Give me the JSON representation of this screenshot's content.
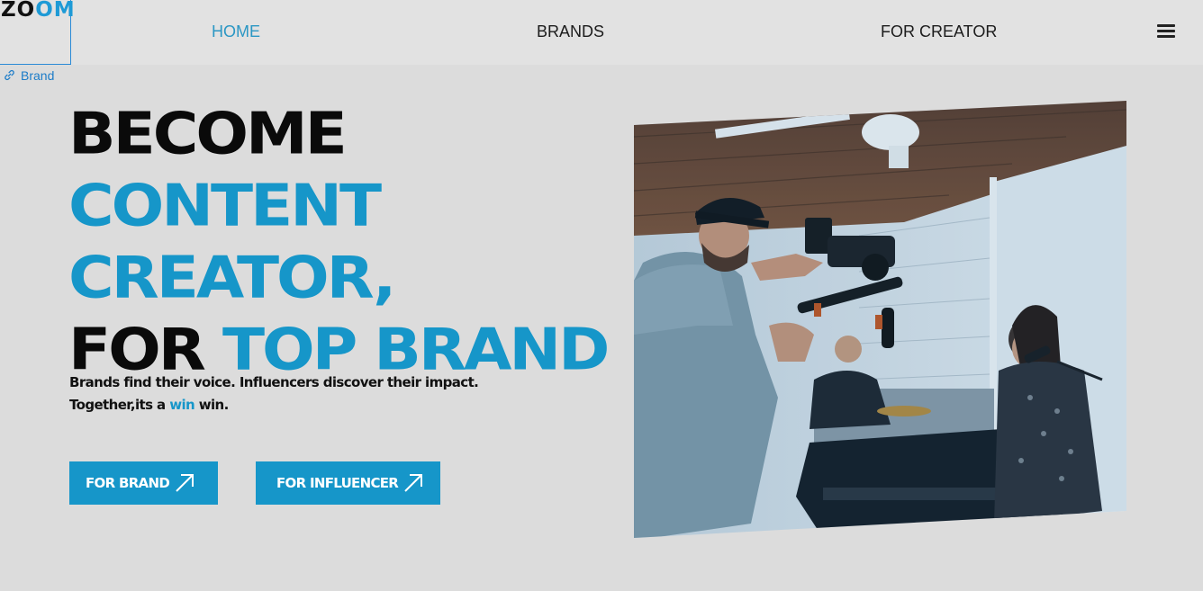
{
  "logo": {
    "part1": "ZO",
    "part2": "OM"
  },
  "nav": {
    "home": "HOME",
    "brands": "BRANDS",
    "for_creator": "FOR CREATOR"
  },
  "brand_link": "Brand",
  "hero": {
    "line1": "BECOME",
    "line2": "CONTENT",
    "line3": "CREATOR,",
    "line4_a": "FOR",
    "line4_b": "TOP BRAND"
  },
  "subtext": {
    "line1": "Brands find their voice. Influencers discover their impact.",
    "line2_a": "Together,its a",
    "line2_win": "win",
    "line2_b": "win."
  },
  "buttons": {
    "for_brand": "FOR BRAND",
    "for_influencer": "FOR INFLUENCER"
  },
  "colors": {
    "accent": "#1696c9",
    "nav_active": "#2b97c4",
    "background": "#dcdcdc"
  },
  "icons": [
    "link-icon",
    "hamburger-menu-icon",
    "arrow-up-right-icon"
  ]
}
